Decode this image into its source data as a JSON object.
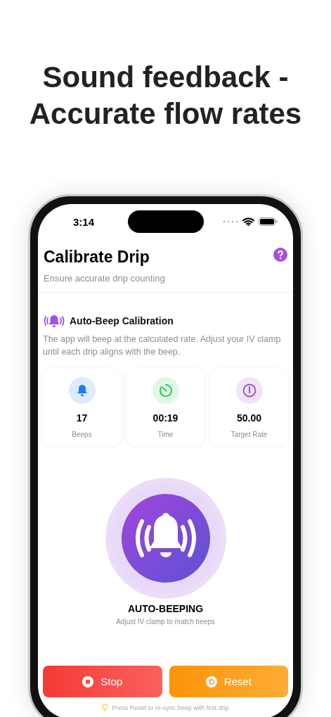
{
  "headline": "Sound feedback - Accurate flow rates",
  "status_bar": {
    "time": "3:14"
  },
  "header": {
    "title": "Calibrate Drip",
    "subtitle": "Ensure accurate drip counting"
  },
  "section": {
    "title": "Auto-Beep Calibration",
    "description": "The app will beep at the calculated rate. Adjust your IV clamp until each drip aligns with the beep."
  },
  "stats": [
    {
      "kind": "beeps",
      "value": "17",
      "label": "Beeps",
      "color": "#1a7cf2"
    },
    {
      "kind": "time",
      "value": "00:19",
      "label": "Time",
      "color": "#34c759"
    },
    {
      "kind": "rate",
      "value": "50.00",
      "label": "Target Rate",
      "color": "#a04ad6"
    }
  ],
  "beeper": {
    "status": "AUTO-BEEPING",
    "hint": "Adjust IV clamp to match beeps"
  },
  "buttons": [
    {
      "kind": "stop",
      "label": "Stop"
    },
    {
      "kind": "reset",
      "label": "Reset"
    }
  ],
  "tip": "Press Reset to re-sync beep with first drip"
}
